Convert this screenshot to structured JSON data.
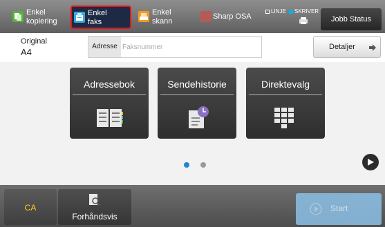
{
  "topbar": {
    "tabs": [
      {
        "label": "Enkel\nkopiering",
        "line1": "Enkel",
        "line2": "kopiering",
        "icon": "copy-icon",
        "color": "#55b13a"
      },
      {
        "label": "Enkel\nfaks",
        "line1": "Enkel",
        "line2": "faks",
        "icon": "fax-icon",
        "color": "#3aa8dc",
        "selected": true
      },
      {
        "label": "Enkel\nskann",
        "line1": "Enkel",
        "line2": "skann",
        "icon": "scan-icon",
        "color": "#f39a1e"
      }
    ],
    "sharp_osa": "Sharp OSA",
    "status_line": "LINJE",
    "status_printer": "SKRIVER",
    "job_status": "Jobb Status"
  },
  "original": {
    "label": "Original",
    "value": "A4"
  },
  "address": {
    "label": "Adresse",
    "placeholder": "Faksnummer",
    "value": ""
  },
  "details_button": "Detaljer",
  "main_buttons": [
    {
      "label": "Adressebok",
      "icon": "address-book-icon"
    },
    {
      "label": "Sendehistorie",
      "icon": "send-history-icon"
    },
    {
      "label": "Direktevalg",
      "icon": "keypad-icon"
    }
  ],
  "pagination": {
    "current": 1,
    "total": 2
  },
  "bottombar": {
    "ca": "CA",
    "preview": "Forhåndsvis",
    "start": "Start"
  },
  "colors": {
    "accent_blue": "#1e86d4",
    "selected_outline": "#e8141c",
    "ca_text": "#ffd21a",
    "start_disabled": "#8cc0e6"
  }
}
